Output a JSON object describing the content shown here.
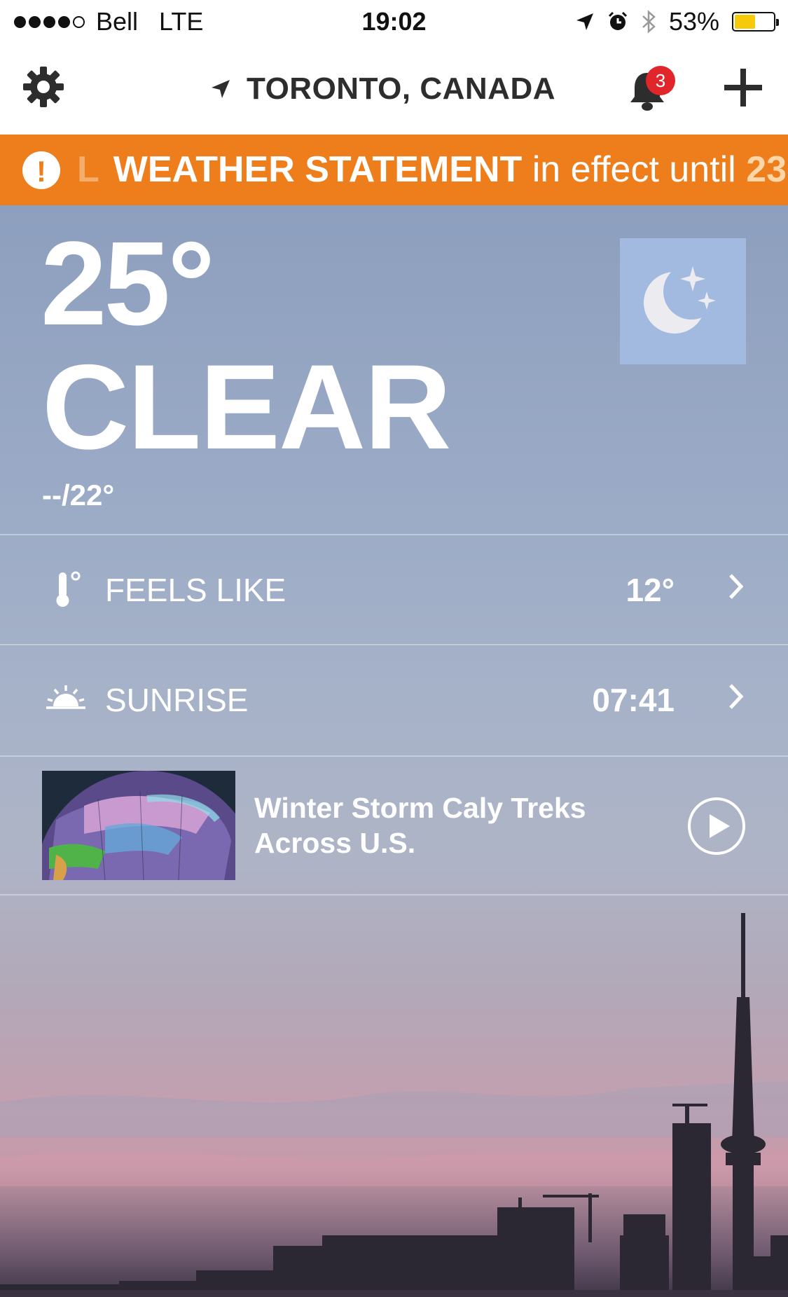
{
  "status_bar": {
    "carrier": "Bell",
    "network": "LTE",
    "time": "19:02",
    "battery_percent": "53%",
    "battery_level": 0.53,
    "battery_color": "#f7c90b",
    "signal_bars_filled": 4,
    "signal_bars_total": 5
  },
  "header": {
    "location": "TORONTO, CANADA",
    "notification_count": "3",
    "icons": [
      "gear-icon",
      "location-arrow-icon",
      "bell-icon",
      "plus-icon"
    ]
  },
  "alert": {
    "faded_prefix": "L",
    "headline": "WEATHER STATEMENT",
    "suffix": " in effect until ",
    "until_partial": "23",
    "color": "#ee7d1b"
  },
  "current": {
    "temperature": "25°",
    "condition": "CLEAR",
    "high_low": "--/22°",
    "icon": "clear-night-moon-icon"
  },
  "details": [
    {
      "label": "FEELS LIKE",
      "value": "12°",
      "icon": "thermometer-icon"
    },
    {
      "label": "SUNRISE",
      "value": "07:41",
      "icon": "sunrise-icon"
    }
  ],
  "video": {
    "title": "Winter Storm Caly Treks Across U.S.",
    "icon": "play-icon"
  }
}
